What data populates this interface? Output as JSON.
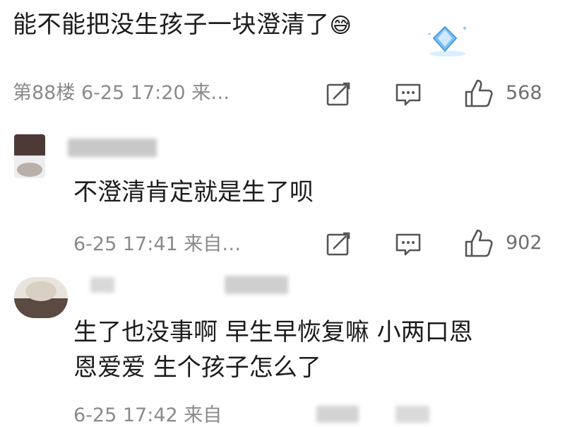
{
  "thread": {
    "post_text": "能不能把没生孩子一块澄清了",
    "post_emoji": "😅",
    "post_meta": "第88楼 6-25 17:20 来…",
    "post_likes": "568"
  },
  "comments": [
    {
      "text": "不澄清肯定就是生了呗",
      "meta": "6-25 17:41 来自…",
      "likes": "902"
    },
    {
      "text_line1": "生了也没事啊 早生早恢复嘛  小两口恩",
      "text_line2": "恩爱爱 生个孩子怎么了",
      "meta": "6-25 17:42 来自"
    }
  ],
  "icons": {
    "edit": "edit-icon",
    "comment": "comment-icon",
    "like": "thumbs-up-icon",
    "decor": "diamond-badge-icon"
  },
  "colors": {
    "text": "#1c1c1c",
    "meta": "#8a8a8a",
    "icon_stroke": "#555555",
    "badge": "#5aa9ef"
  }
}
